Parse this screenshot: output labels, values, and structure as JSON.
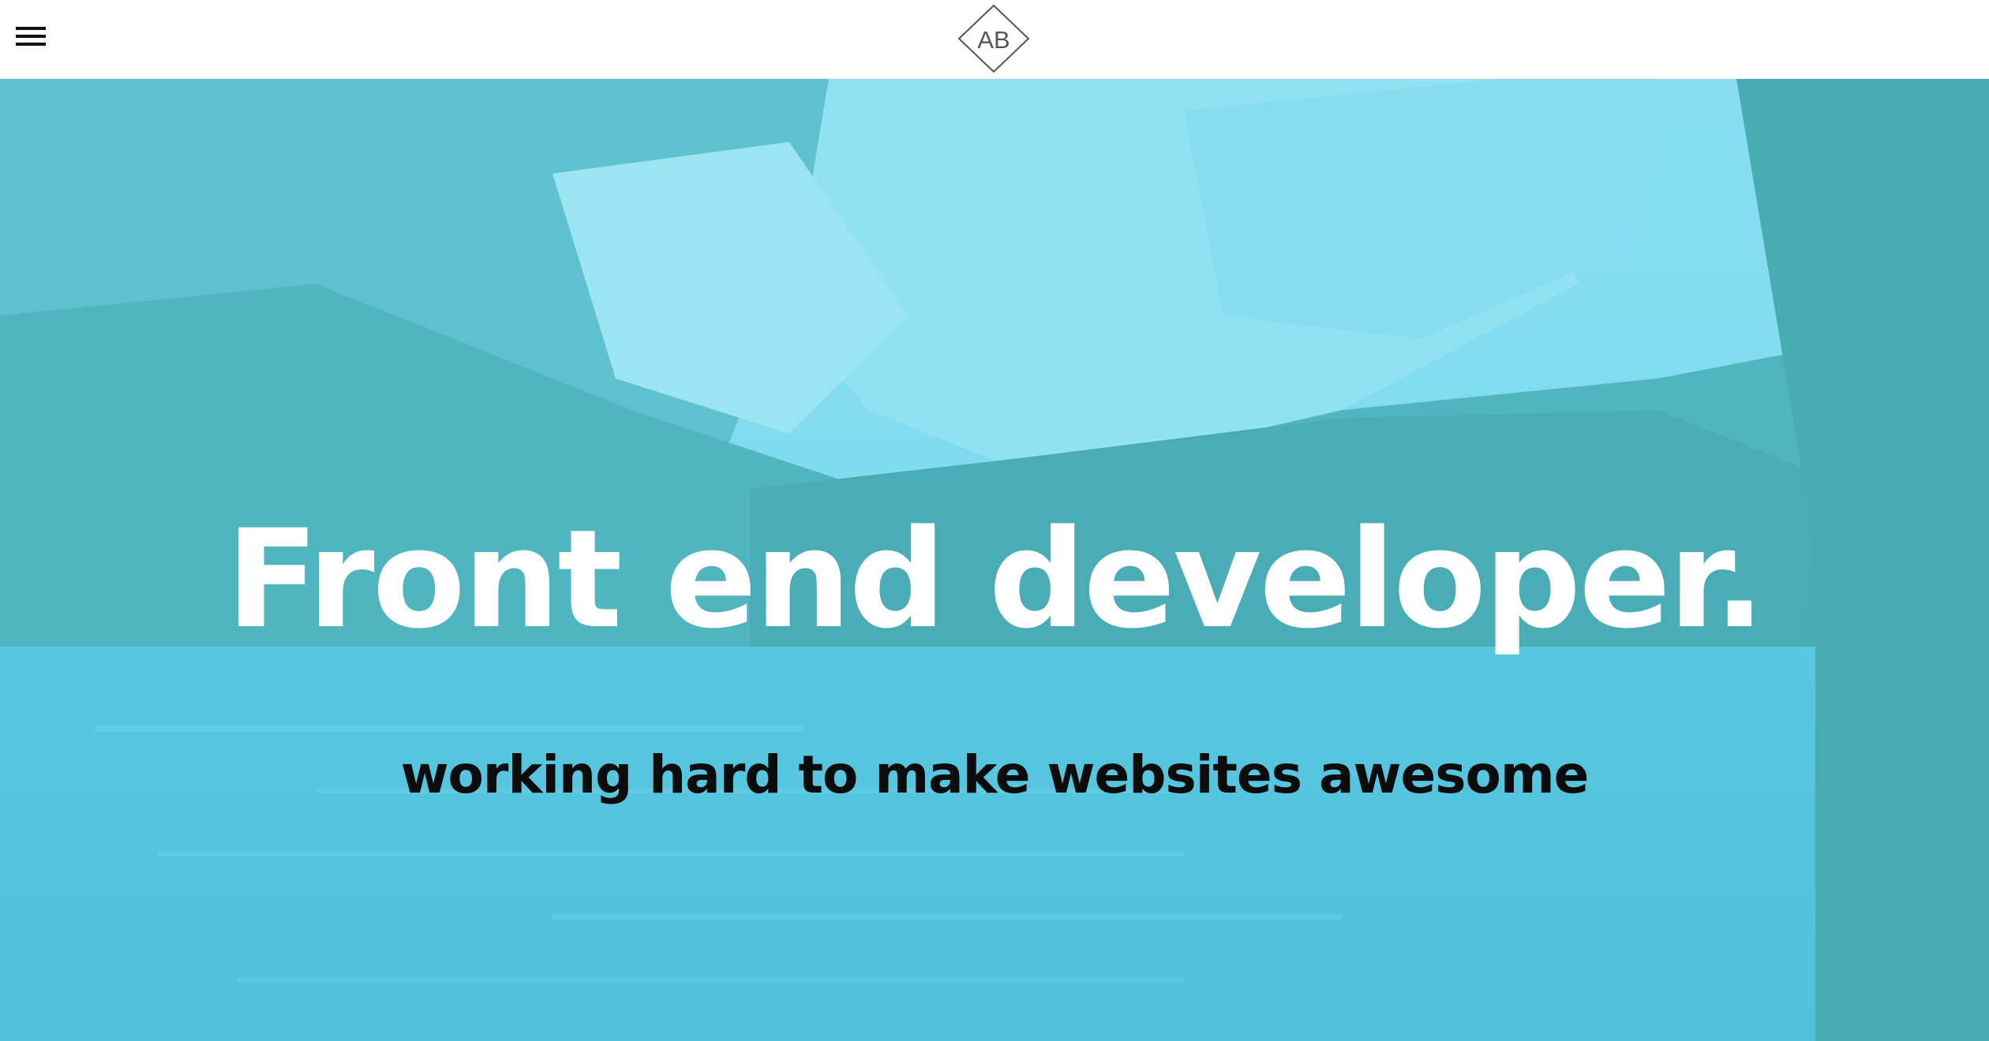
{
  "header": {
    "menu_icon": "hamburger-menu-icon",
    "logo": {
      "text": "AB",
      "shape": "diamond-outline"
    }
  },
  "hero": {
    "title": "Front end developer.",
    "subtitle": "working hard to make websites awesome",
    "background": "mountain-lake-photo",
    "overlay_color": "#5fd4ea"
  },
  "colors": {
    "header_bg": "#ffffff",
    "title_text": "#ffffff",
    "subtitle_text": "#0c0c0c",
    "logo_stroke": "#555555"
  }
}
